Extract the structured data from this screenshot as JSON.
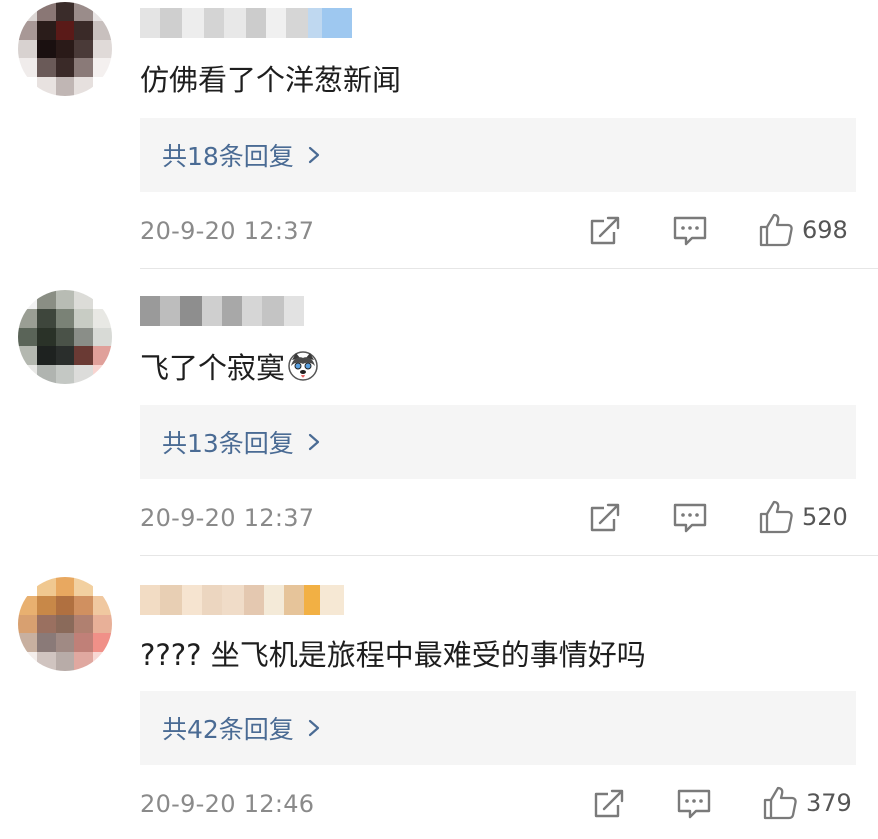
{
  "comments": [
    {
      "text": "仿佛看了个洋葱新闻",
      "replies_label": "共18条回复",
      "timestamp": "20-9-20 12:37",
      "likes": "698",
      "avatar_colors": [
        "#dcd6d4",
        "#8a7775",
        "#3a2c2a",
        "#9a8c8a",
        "#e8e4e4",
        "#a89896",
        "#2a1c1a",
        "#5a1a18",
        "#3a2a28",
        "#c8c0be",
        "#d8d2d0",
        "#1a1010",
        "#2a1a18",
        "#4a3a38",
        "#e0dad8",
        "#f0eceb",
        "#6a5a58",
        "#3a2a28",
        "#8a7a78",
        "#f4f0ef",
        "#ffffff",
        "#e8e2e0",
        "#c0b6b4",
        "#e6e0de",
        "#ffffff"
      ],
      "name_colors": [
        "#e4e4e4",
        "#cfcfcf",
        "#ededed",
        "#d4d4d4",
        "#e8e8e8",
        "#cccccc",
        "#f0f0f0",
        "#d6d6d6",
        "#bfd8f0",
        "#9ec8f0"
      ]
    },
    {
      "text": "飞了个寂寞",
      "replies_label": "共13条回复",
      "timestamp": "20-9-20 12:37",
      "likes": "520",
      "avatar_colors": [
        "#f2f2f2",
        "#8a8e84",
        "#b8bcb4",
        "#dcdcd8",
        "#ffffff",
        "#9a9e94",
        "#3e463c",
        "#7a8276",
        "#c8ccc4",
        "#e8e8e4",
        "#5a6458",
        "#2a3228",
        "#4a5248",
        "#8a8e88",
        "#d8dad6",
        "#b4b8b0",
        "#1e2220",
        "#2a2e2c",
        "#6a3a34",
        "#e0a09a",
        "#e8e8e6",
        "#b0b4b0",
        "#c4c8c4",
        "#dcdcda",
        "#f8d4d0"
      ],
      "name_colors": [
        "#9a9a9a",
        "#bdbdbd",
        "#8e8e8e",
        "#cfcfcf",
        "#a8a8a8",
        "#d6d6d6",
        "#c4c4c4",
        "#e2e2e2"
      ]
    },
    {
      "text": "???? 坐飞机是旅程中最难受的事情好吗",
      "replies_label": "共42条回复",
      "timestamp": "20-9-20 12:46",
      "likes": "379",
      "avatar_colors": [
        "#ffffff",
        "#f0c890",
        "#e8a860",
        "#f2d0a0",
        "#ffffff",
        "#e8b070",
        "#c88848",
        "#b07040",
        "#d09060",
        "#f0c8a0",
        "#d8a070",
        "#9a7060",
        "#8a6a5a",
        "#b08070",
        "#e8b098",
        "#c8b0a0",
        "#8a7a78",
        "#a08a84",
        "#c08078",
        "#f09088",
        "#f4eeec",
        "#d0c4c0",
        "#b8aca8",
        "#e0a8a0",
        "#f8d8d4"
      ],
      "name_colors": [
        "#f2dcc4",
        "#e8cfb4",
        "#f6e4d0",
        "#ecd6c0",
        "#f0dcc8",
        "#e4c8b0",
        "#f4ead8",
        "#e6c49a",
        "#f2b044",
        "#f6e8d4"
      ]
    }
  ]
}
